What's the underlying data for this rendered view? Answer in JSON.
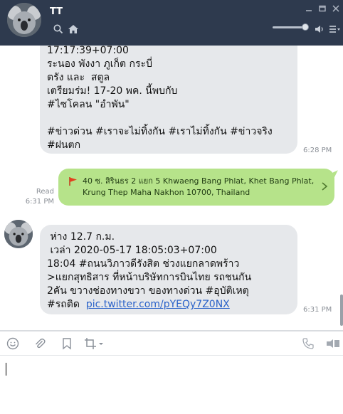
{
  "header": {
    "title": "TT",
    "icons": [
      "search-icon",
      "home-icon",
      "volume-icon",
      "menu-icon",
      "minimize-icon",
      "maximize-icon",
      "close-icon"
    ],
    "volume_level": 0.85,
    "bg_color": "#2e3a4e"
  },
  "messages": [
    {
      "direction": "incoming",
      "lines": [
        "17:17:39+07:00",
        "ระนอง พังงา ภูเก็ต กระบี่",
        "ตรัง และ  สตูล",
        "เตรียมร่ม! 17-20 พค. นี้พบกับ",
        "#ไซโคลน \"อำพัน\"",
        "",
        "#ข่าวด่วน #เราจะไม่ทิ้งกัน #เราไม่ทิ้งกัน #ข่าวจริง",
        "#ฝนตก"
      ],
      "time": "6:28 PM"
    },
    {
      "direction": "outgoing",
      "type": "location",
      "read_label": "Read",
      "time": "6:31 PM",
      "address_line1": "40 ซ. สิรินธร 2 แยก 5 Khwaeng Bang Phlat, Khet Bang Phlat,",
      "address_line2": "Krung Thep Maha Nakhon 10700, Thailand",
      "color": "#b6e38a"
    },
    {
      "direction": "incoming",
      "lines": [
        " ห่าง 12.7 ก.ม.",
        " เวล่า 2020-05-17 18:05:03+07:00",
        "18:04 #ถนนวิภาวดีรังสิต ช่วงแยกลาดพร้าว",
        ">แยกสุทธิสาร ที่หน้าบริษัทการบินไทย รถชนกัน",
        "2คัน ขวางช่องทางขวา ของทางด่วน #อุบัติเหตุ"
      ],
      "last_line_prefix": "#รถติด  ",
      "link": "pic.twitter.com/pYEQy7Z0NX",
      "time": "6:31 PM"
    }
  ],
  "toolbar": {
    "icons": [
      "emoji-icon",
      "attach-icon",
      "bookmark-icon",
      "crop-icon",
      "phone-icon",
      "video-icon"
    ]
  },
  "input": {
    "value": ""
  }
}
